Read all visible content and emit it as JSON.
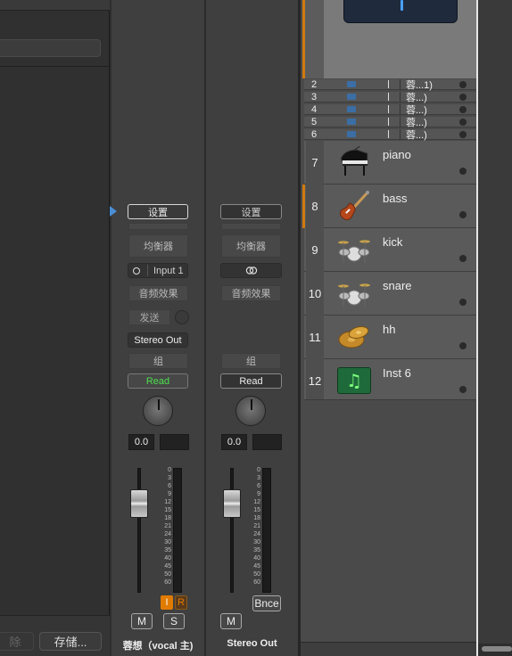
{
  "left_panel": {
    "delete_label": "除",
    "save_label": "存储..."
  },
  "strips": [
    {
      "setting": "设置",
      "eq": "均衡器",
      "input": "Input 1",
      "audio_fx": "音频效果",
      "send": "发送",
      "output": "Stereo Out",
      "group": "组",
      "automation": "Read",
      "value": "0.0",
      "mute": "M",
      "solo": "S",
      "input_mon": "I",
      "record": "R",
      "name": "蓉想（vocal 主)"
    },
    {
      "setting": "设置",
      "eq": "均衡器",
      "audio_fx": "音频效果",
      "group": "组",
      "automation": "Read",
      "value": "0.0",
      "mute": "M",
      "bounce": "Bnce",
      "name": "Stereo Out"
    }
  ],
  "meter_scale": [
    "0",
    "3",
    "6",
    "9",
    "12",
    "15",
    "18",
    "21",
    "24",
    "30",
    "35",
    "40",
    "45",
    "50",
    "60"
  ],
  "sub_tracks": [
    {
      "num": "2",
      "name": "蓉...1)"
    },
    {
      "num": "3",
      "name": "蓉...)"
    },
    {
      "num": "4",
      "name": "蓉...)"
    },
    {
      "num": "5",
      "name": "蓉...)"
    },
    {
      "num": "6",
      "name": "蓉...)"
    }
  ],
  "tracks": [
    {
      "num": "7",
      "name": "piano",
      "icon": "piano-icon"
    },
    {
      "num": "8",
      "name": "bass",
      "icon": "bass-guitar-icon"
    },
    {
      "num": "9",
      "name": "kick",
      "icon": "drum-kit-icon"
    },
    {
      "num": "10",
      "name": "snare",
      "icon": "drum-kit-icon"
    },
    {
      "num": "11",
      "name": "hh",
      "icon": "cymbal-icon"
    },
    {
      "num": "12",
      "name": "Inst 6",
      "icon": "music-note-icon"
    }
  ],
  "colors": {
    "read_green": "#4ce04c",
    "orange": "#d07a10",
    "input_orange": "#e07b00"
  }
}
